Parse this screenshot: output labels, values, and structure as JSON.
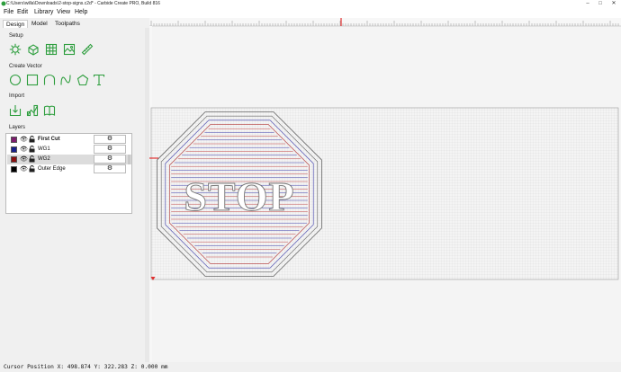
{
  "window": {
    "title": "C:\\Users\\willa\\Downloads\\2-stop-signs.c2d* - Carbide Create PRO, Build 816",
    "minimize_label": "–",
    "maximize_label": "□",
    "close_label": "✕"
  },
  "menu": [
    "File",
    "Edit",
    "Library",
    "View",
    "Help"
  ],
  "tabs": [
    {
      "label": "Design",
      "active": true
    },
    {
      "label": "Model",
      "active": false
    },
    {
      "label": "Toolpaths",
      "active": false
    }
  ],
  "sections": {
    "setup": "Setup",
    "create_vector": "Create Vector",
    "import": "Import",
    "layers": "Layers"
  },
  "setup_tools": [
    "job-setup-icon",
    "rectangle-stock-icon",
    "grid-icon",
    "image-icon",
    "measure-icon"
  ],
  "vector_tools": [
    "circle-icon",
    "rectangle-icon",
    "curve-icon",
    "polygon-shape-icon",
    "pentagon-icon",
    "text-icon"
  ],
  "import_tools": [
    "import-file-icon",
    "import-svg-icon",
    "library-book-icon"
  ],
  "layers": [
    {
      "name": "First Cut",
      "color": "#7d1d6e",
      "bold": true,
      "selected": false
    },
    {
      "name": "WG1",
      "color": "#17208a",
      "bold": false,
      "selected": false
    },
    {
      "name": "WG2",
      "color": "#8b1010",
      "bold": false,
      "selected": true
    },
    {
      "name": "Outer Edge",
      "color": "#000000",
      "bold": false,
      "selected": false
    }
  ],
  "canvas": {
    "sign_text": "STOP",
    "accent": "#2e9e3e",
    "red_marker": "#e03030"
  },
  "status": {
    "cursor_position": "Cursor Position X: 498.874 Y: 322.283 Z: 0.000 mm"
  }
}
